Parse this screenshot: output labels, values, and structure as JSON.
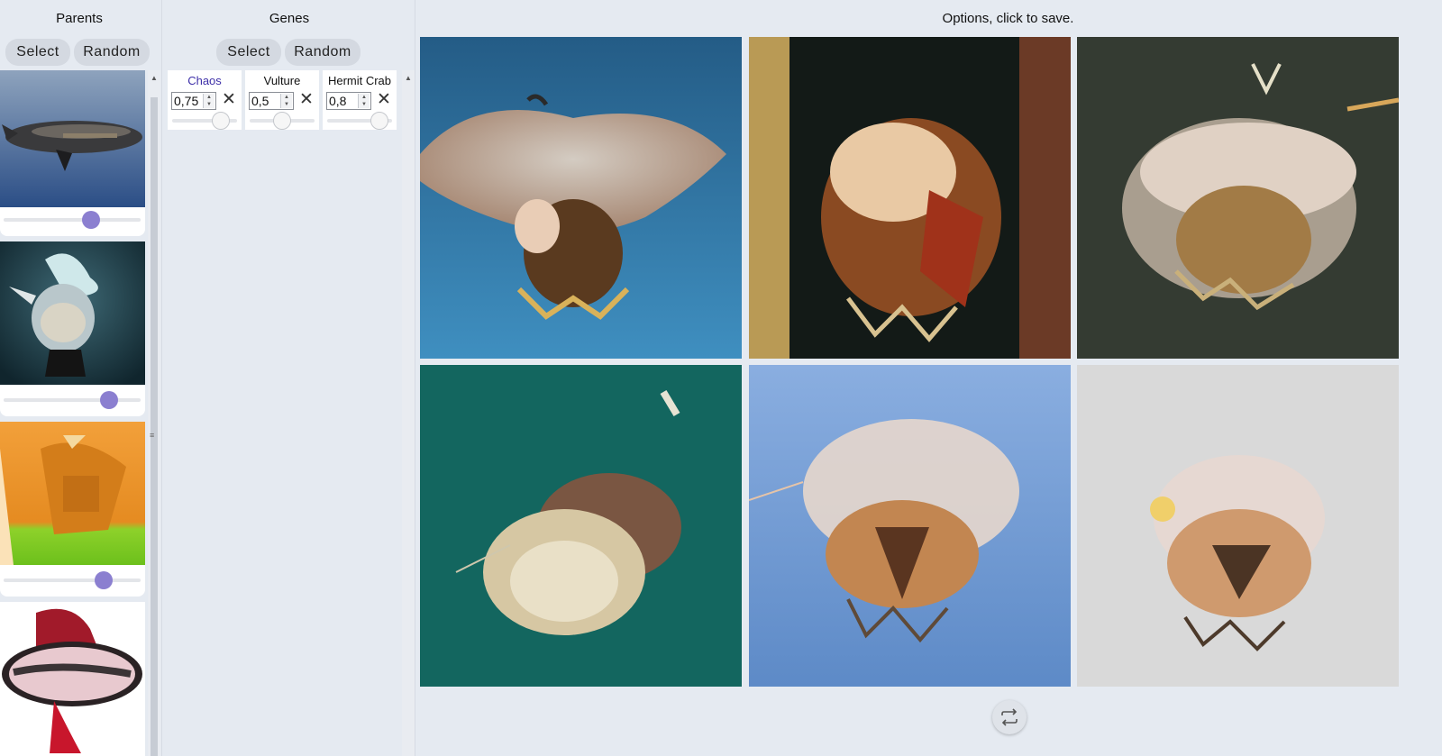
{
  "parents": {
    "title": "Parents",
    "select_label": "Select",
    "random_label": "Random",
    "items": [
      {
        "image": "airship-whale",
        "weight": 0.64
      },
      {
        "image": "ceramic-figure",
        "weight": 0.77
      },
      {
        "image": "orange-lantern",
        "weight": 0.73
      },
      {
        "image": "red-sunglasses",
        "weight": null
      }
    ]
  },
  "genes": {
    "title": "Genes",
    "select_label": "Select",
    "random_label": "Random",
    "items": [
      {
        "name": "Chaos",
        "value": "0,75",
        "name_color": "#3d2fa8",
        "level": 0.75
      },
      {
        "name": "Vulture",
        "value": "0,5",
        "name_color": "#111111",
        "level": 0.5
      },
      {
        "name": "Hermit Crab",
        "value": "0,8",
        "name_color": "#111111",
        "level": 0.8
      }
    ]
  },
  "options": {
    "title": "Options, click to save.",
    "images": [
      "jellyfish-blue",
      "jellyfish-dark-wood",
      "jellyfish-dark-green",
      "jellyfish-teal",
      "jellyfish-sky-blue",
      "jellyfish-grey"
    ],
    "regenerate_icon": "repeat-icon"
  },
  "colors": {
    "background": "#e5eaf1",
    "slider_accent": "#8b7fd0",
    "button": "#d4d9e1"
  }
}
